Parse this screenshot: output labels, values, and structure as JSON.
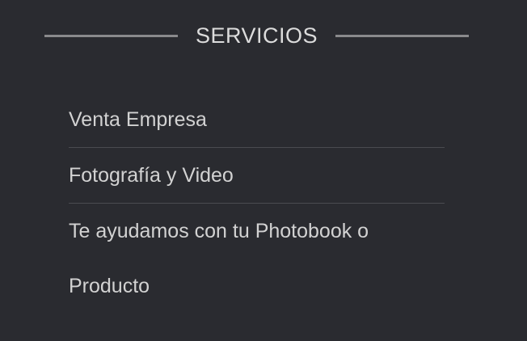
{
  "section": {
    "title": "SERVICIOS"
  },
  "menu": {
    "items": [
      {
        "label": "Venta Empresa"
      },
      {
        "label": "Fotografía y Video"
      },
      {
        "label": "Te ayudamos con tu Photobook o Producto"
      }
    ]
  },
  "colors": {
    "background": "#2a2b30",
    "text": "#d2d2d2",
    "divider": "#4a4b50",
    "header_line": "#8a8a8c"
  }
}
